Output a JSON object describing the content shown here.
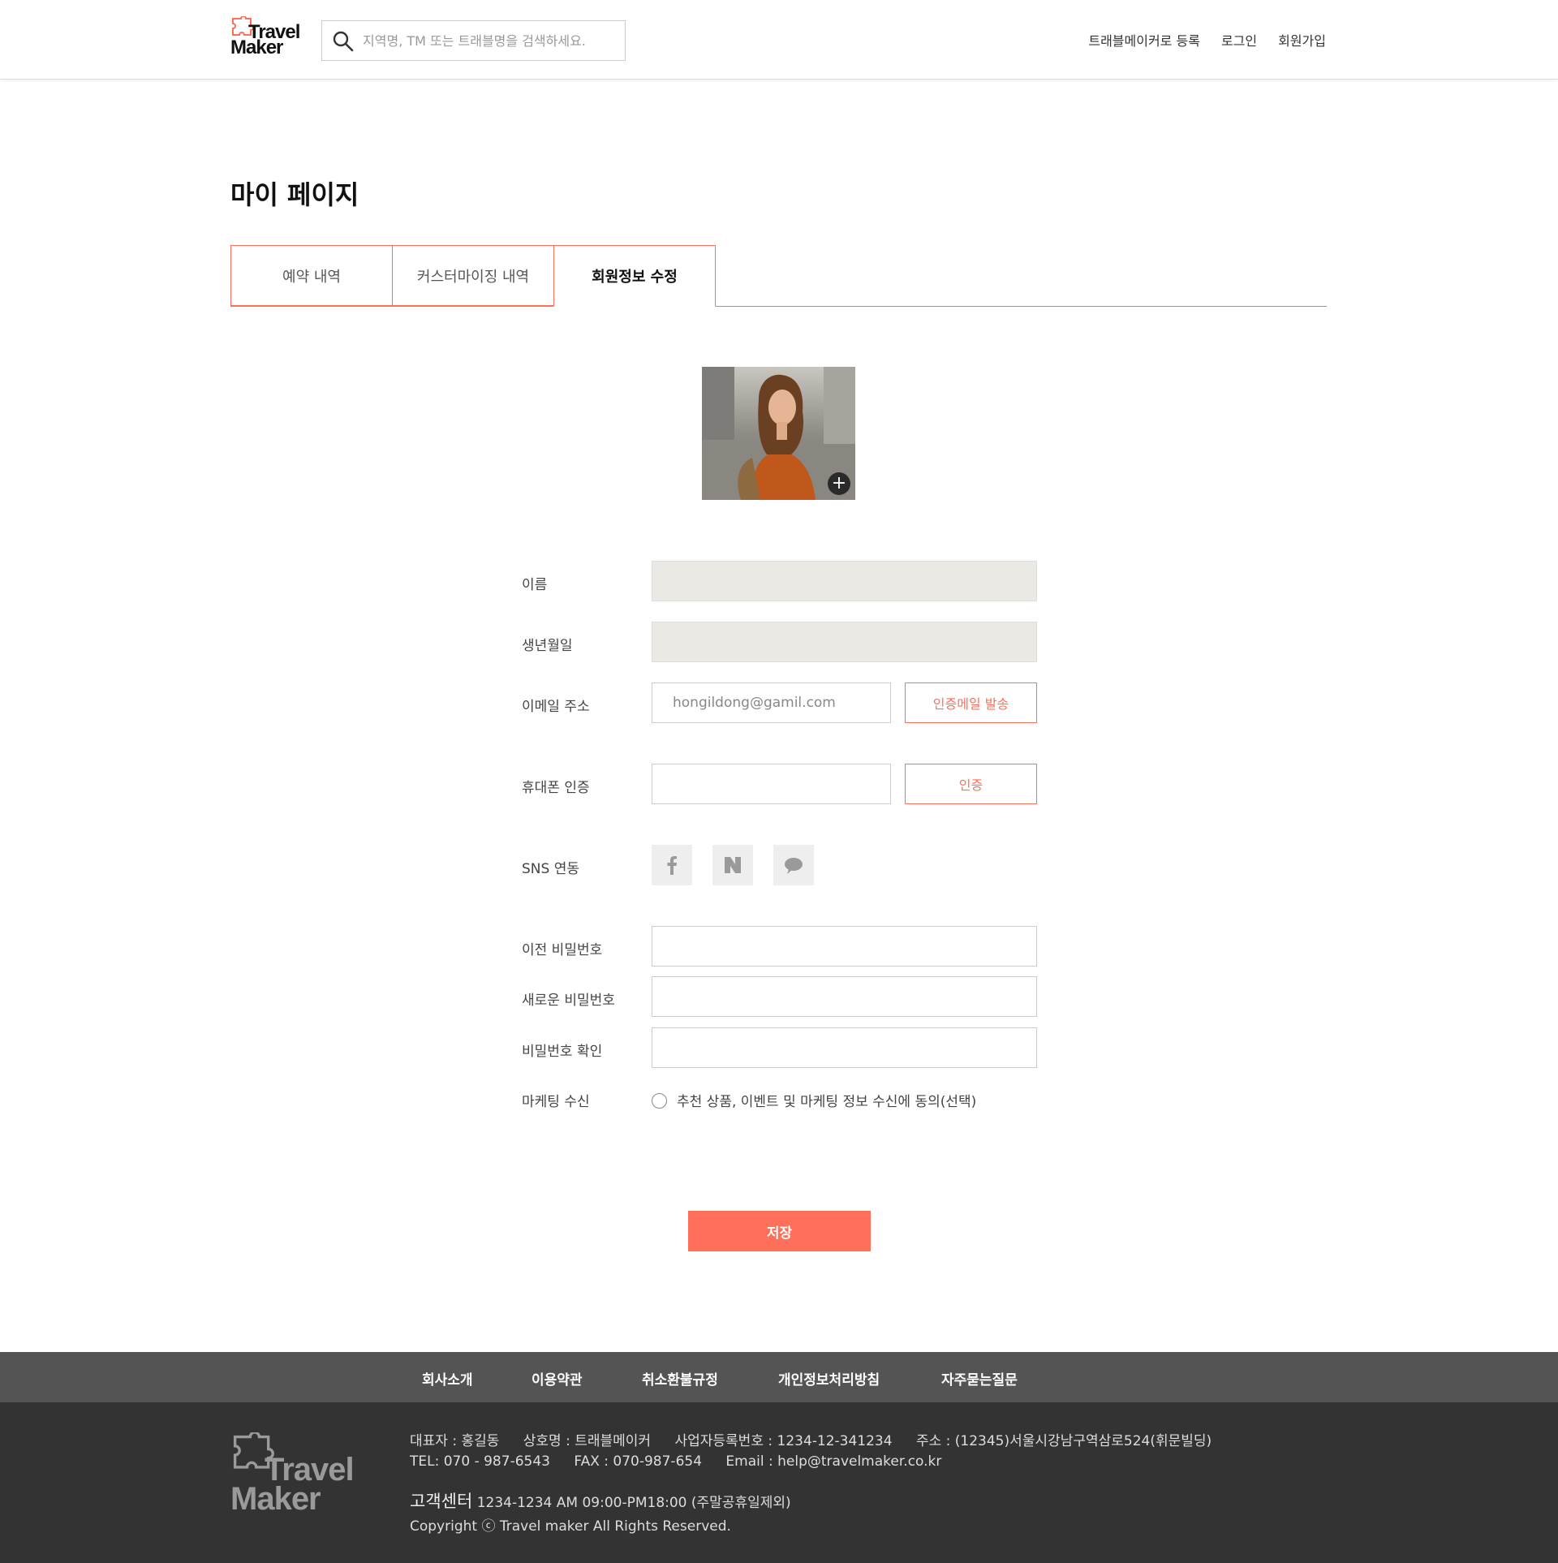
{
  "header": {
    "logo_line1": "Travel",
    "logo_line2": "Maker",
    "search_placeholder": "지역명, TM 또는 트래블명을 검색하세요.",
    "nav": [
      "트래블메이커로 등록",
      "로그인",
      "회원가입"
    ]
  },
  "page": {
    "title": "마이 페이지",
    "tabs": [
      "예약 내역",
      "커스터마이징 내역",
      "회원정보 수정"
    ],
    "active_tab": "회원정보 수정"
  },
  "form": {
    "name_label": "이름",
    "birth_label": "생년월일",
    "email_label": "이메일 주소",
    "email_placeholder": "hongildong@gamil.com",
    "email_button": "인증메일 발송",
    "phone_label": "휴대폰 인증",
    "phone_button": "인증",
    "sns_label": "SNS 연동",
    "sns_icons": [
      "facebook-icon",
      "naver-icon",
      "kakaotalk-icon"
    ],
    "old_pw_label": "이전 비밀번호",
    "new_pw_label": "새로운 비밀번호",
    "confirm_pw_label": "비밀번호 확인",
    "marketing_label": "마케팅 수신",
    "marketing_text": "추천 상품, 이벤트 및 마케팅 정보 수신에 동의(선택)",
    "marketing_checked": false,
    "save_button": "저장"
  },
  "footer": {
    "nav": [
      "회사소개",
      "이용약관",
      "취소환불규정",
      "개인정보처리방침",
      "자주묻는질문"
    ],
    "logo_line1": "Travel",
    "logo_line2": "Maker",
    "ceo": "대표자 : 홍길동",
    "company": "상호명 : 트래블메이커",
    "biz_no": "사업자등록번호 : 1234-12-341234",
    "address": "주소 : (12345)서울시강남구역삼로524(휘문빌딩)",
    "tel": "TEL: 070 - 987-6543",
    "fax": "FAX : 070-987-654",
    "email": "Email : help@travelmaker.co.kr",
    "cc_title": "고객센터",
    "cc_info": "1234-1234   AM 09:00-PM18:00 (주말공휴일제외)",
    "copyright": "Copyright ⓒ Travel maker All Rights Reserved."
  },
  "colors": {
    "accent": "#ff6f5a",
    "footer_nav_bg": "#545454",
    "footer_bg": "#333333",
    "disabled_field": "#eae9e3"
  }
}
